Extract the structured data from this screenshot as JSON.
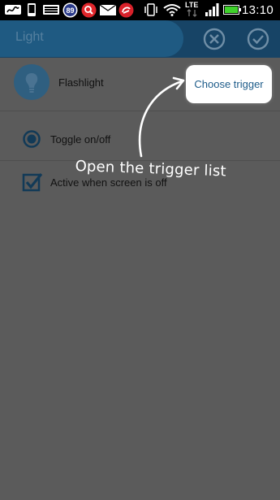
{
  "status_bar": {
    "time": "13:10",
    "notification_badge": "89",
    "network_label": "LTE",
    "icons": [
      "signature-icon",
      "phone-icon",
      "keyboard-icon",
      "badge-89-icon",
      "search-app-icon",
      "mail-icon",
      "security-app-icon",
      "vibrate-icon",
      "wifi-icon",
      "lte-icon",
      "signal-icon",
      "battery-icon"
    ]
  },
  "app_bar": {
    "title": "Light",
    "cancel_icon": "cancel-circle-icon",
    "confirm_icon": "check-circle-icon"
  },
  "rows": {
    "action_label": "Flashlight",
    "action_icon": "lightbulb-icon",
    "trigger_button": "Choose trigger",
    "toggle_label": "Toggle on/off",
    "screen_label": "Active when screen is off"
  },
  "hint": {
    "text": "Open the trigger list"
  },
  "colors": {
    "accent": "#1e5c8a",
    "overlay": "#5b5b5b",
    "app_bar": "#174466"
  }
}
